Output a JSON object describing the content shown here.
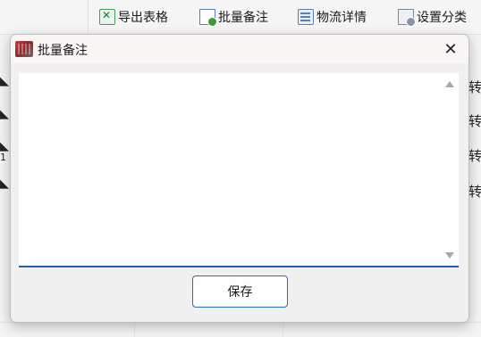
{
  "toolbar": {
    "items": [
      {
        "label": "导出表格",
        "icon": "excel-export-icon"
      },
      {
        "label": "批量备注",
        "icon": "batch-note-icon"
      },
      {
        "label": "物流详情",
        "icon": "logistics-icon"
      },
      {
        "label": "设置分类",
        "icon": "category-settings-icon"
      }
    ]
  },
  "background_rows": {
    "right_text": [
      "转",
      "转",
      "转",
      "转"
    ],
    "left_digit": "1"
  },
  "dialog": {
    "title": "批量备注",
    "close_symbol": "✕",
    "note_value": "",
    "save_label": "保存"
  },
  "colors": {
    "accent": "#1d62a8",
    "dialog_bg": "#f0f0f0",
    "titlebar_bg": "#fbf6f6"
  }
}
